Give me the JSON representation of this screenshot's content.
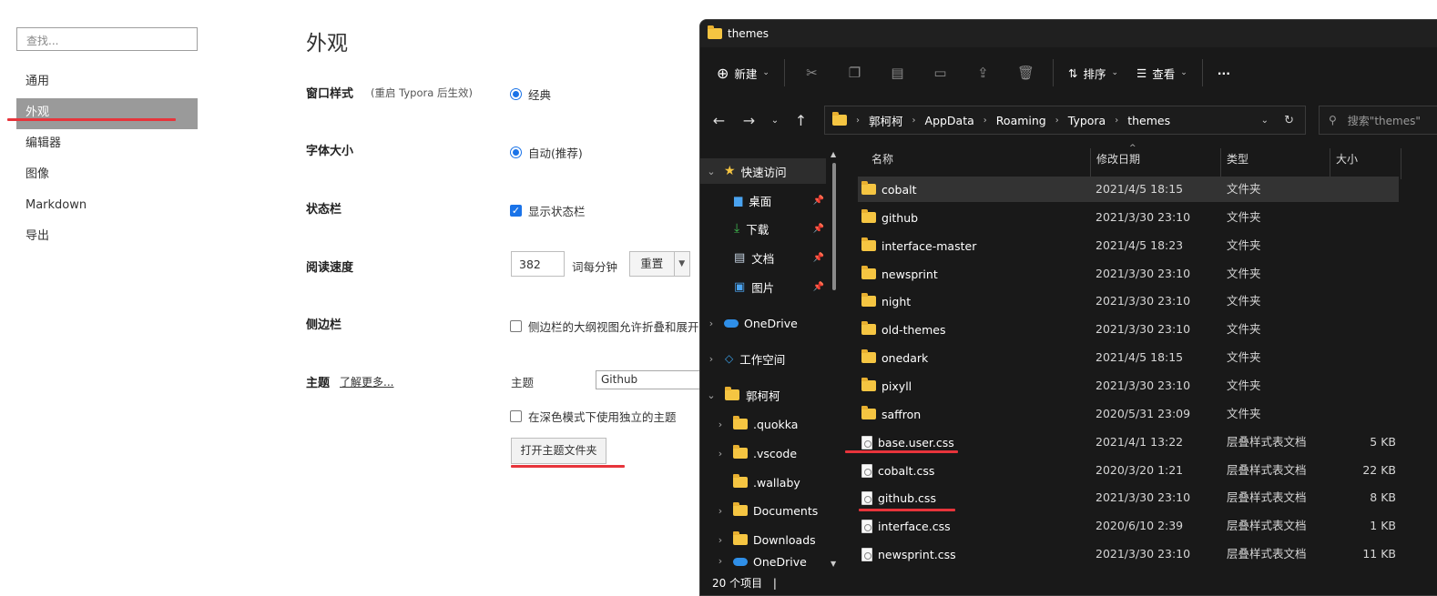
{
  "typora": {
    "search_placeholder": "查找...",
    "nav": [
      "通用",
      "外观",
      "编辑器",
      "图像",
      "Markdown",
      "导出"
    ],
    "active_nav": "外观",
    "title": "外观",
    "window_style": {
      "label": "窗口样式",
      "note": "(重启 Typora 后生效)",
      "option": "经典"
    },
    "font_size": {
      "label": "字体大小",
      "option": "自动(推荐)"
    },
    "status_bar": {
      "label": "状态栏",
      "option": "显示状态栏",
      "checked": true
    },
    "reading_speed": {
      "label": "阅读速度",
      "value": "382",
      "unit": "词每分钟",
      "reset": "重置"
    },
    "sidebar": {
      "label": "侧边栏",
      "option": "侧边栏的大纲视图允许折叠和展开",
      "checked": false
    },
    "theme": {
      "label": "主题",
      "learn_more": "了解更多...",
      "field_label": "主题",
      "value": "Github",
      "dark_option": "在深色模式下使用独立的主题",
      "dark_checked": false,
      "open_folder": "打开主题文件夹"
    }
  },
  "explorer": {
    "title": "themes",
    "toolbar": {
      "new": "新建",
      "sort": "排序",
      "view": "查看",
      "more": "···"
    },
    "breadcrumb": [
      "郭柯柯",
      "AppData",
      "Roaming",
      "Typora",
      "themes"
    ],
    "search_placeholder": "搜索\"themes\"",
    "nav_pane": {
      "quick_access": "快速访问",
      "quick_items": [
        "桌面",
        "下载",
        "文档",
        "图片"
      ],
      "onedrive": "OneDrive",
      "workspace": "工作空间",
      "user": "郭柯柯",
      "user_children": [
        ".quokka",
        ".vscode",
        ".wallaby",
        "Documents",
        "Downloads",
        "OneDrive"
      ]
    },
    "columns": [
      "名称",
      "修改日期",
      "类型",
      "大小"
    ],
    "files": [
      {
        "name": "cobalt",
        "date": "2021/4/5 18:15",
        "type": "文件夹",
        "size": "",
        "kind": "folder",
        "selected": true
      },
      {
        "name": "github",
        "date": "2021/3/30 23:10",
        "type": "文件夹",
        "size": "",
        "kind": "folder"
      },
      {
        "name": "interface-master",
        "date": "2021/4/5 18:23",
        "type": "文件夹",
        "size": "",
        "kind": "folder"
      },
      {
        "name": "newsprint",
        "date": "2021/3/30 23:10",
        "type": "文件夹",
        "size": "",
        "kind": "folder"
      },
      {
        "name": "night",
        "date": "2021/3/30 23:10",
        "type": "文件夹",
        "size": "",
        "kind": "folder"
      },
      {
        "name": "old-themes",
        "date": "2021/3/30 23:10",
        "type": "文件夹",
        "size": "",
        "kind": "folder"
      },
      {
        "name": "onedark",
        "date": "2021/4/5 18:15",
        "type": "文件夹",
        "size": "",
        "kind": "folder"
      },
      {
        "name": "pixyll",
        "date": "2021/3/30 23:10",
        "type": "文件夹",
        "size": "",
        "kind": "folder"
      },
      {
        "name": "saffron",
        "date": "2020/5/31 23:09",
        "type": "文件夹",
        "size": "",
        "kind": "folder"
      },
      {
        "name": "base.user.css",
        "date": "2021/4/1 13:22",
        "type": "层叠样式表文档",
        "size": "5 KB",
        "kind": "file"
      },
      {
        "name": "cobalt.css",
        "date": "2020/3/20 1:21",
        "type": "层叠样式表文档",
        "size": "22 KB",
        "kind": "file"
      },
      {
        "name": "github.css",
        "date": "2021/3/30 23:10",
        "type": "层叠样式表文档",
        "size": "8 KB",
        "kind": "file"
      },
      {
        "name": "interface.css",
        "date": "2020/6/10 2:39",
        "type": "层叠样式表文档",
        "size": "1 KB",
        "kind": "file"
      },
      {
        "name": "newsprint.css",
        "date": "2021/3/30 23:10",
        "type": "层叠样式表文档",
        "size": "11 KB",
        "kind": "file"
      }
    ],
    "status": "20 个项目"
  },
  "colors": {
    "accent": "#1a73e8",
    "annotation": "#e7343b",
    "explorer_bg": "#191919",
    "folder": "#f5c542"
  }
}
